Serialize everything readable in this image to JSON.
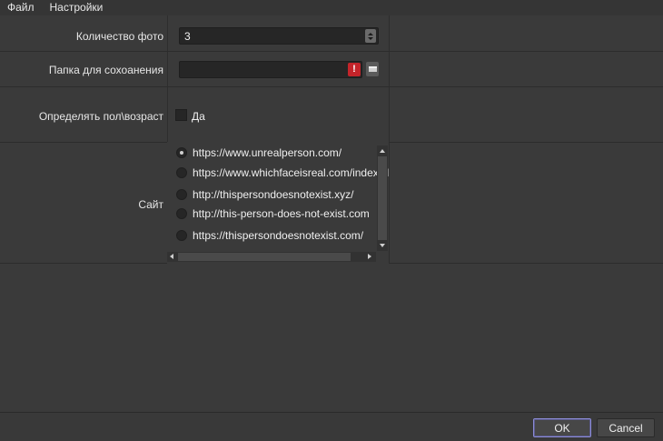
{
  "menu": {
    "file": "Файл",
    "settings": "Настройки"
  },
  "form": {
    "photo_count_label": "Количество фото",
    "photo_count_value": "3",
    "folder_label": "Папка для сохоанения",
    "folder_value": "",
    "folder_warning": "!",
    "gender_age_label": "Определять пол\\возраст",
    "gender_age_checkbox_label": "Да",
    "gender_age_checked": false,
    "site_label": "Сайт",
    "sites": [
      {
        "url": "https://www.unrealperson.com/",
        "selected": true
      },
      {
        "url": "https://www.whichfaceisreal.com/index.php",
        "selected": false
      },
      {
        "url": "http://thispersondoesnotexist.xyz/",
        "selected": false
      },
      {
        "url": "http://this-person-does-not-exist.com",
        "selected": false
      },
      {
        "url": "https://thispersondoesnotexist.com/",
        "selected": false
      }
    ]
  },
  "buttons": {
    "ok": "OK",
    "cancel": "Cancel"
  },
  "colors": {
    "background": "#3a3a3a",
    "field": "#262626",
    "warning": "#c4242a",
    "ok_focus": "#8c8cd8"
  },
  "icons": {
    "spin": "up-down-arrows",
    "warning": "exclamation-icon",
    "browse": "folder-icon"
  }
}
